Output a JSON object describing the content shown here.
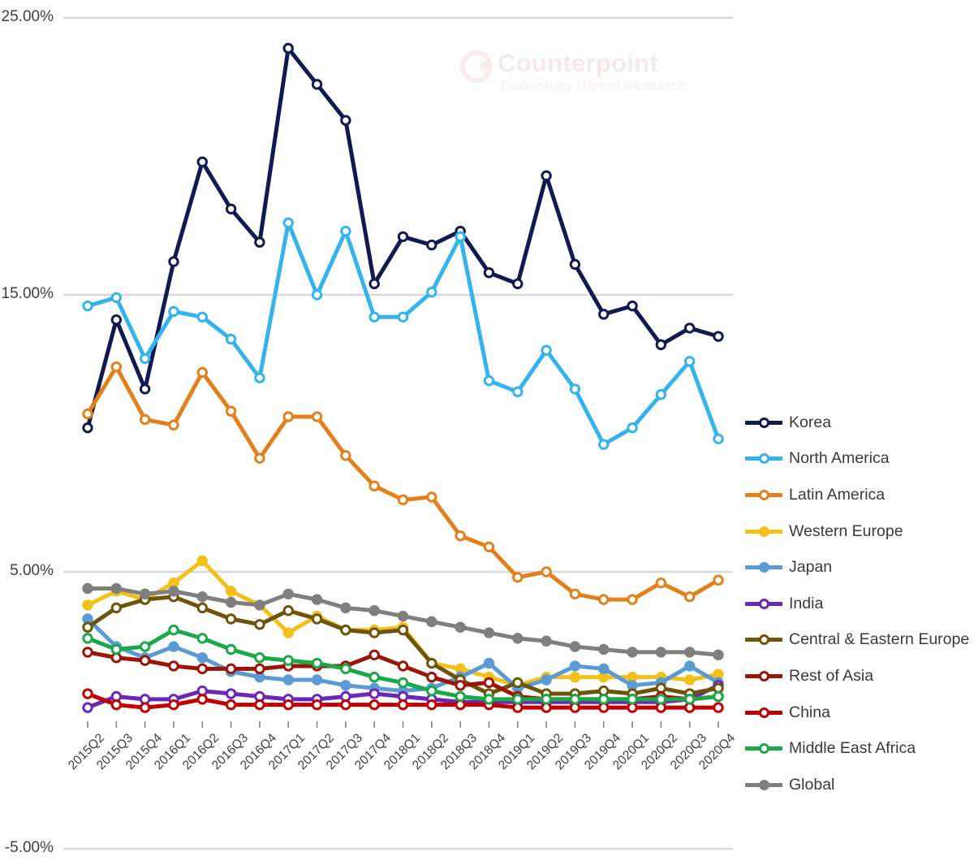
{
  "watermark": {
    "title": "Counterpoint",
    "subtitle": "Technology Market Research",
    "logo_icon": "counterpoint-logo-icon"
  },
  "axes": {
    "y_ticks": [
      "25.00%",
      "15.00%",
      "5.00%",
      "-5.00%"
    ],
    "y_tick_values": [
      25,
      15,
      5,
      -5
    ],
    "x_ticks": [
      "2015Q2",
      "2015Q3",
      "2015Q4",
      "2016Q1",
      "2016Q2",
      "2016Q3",
      "2016Q4",
      "2017Q1",
      "2017Q2",
      "2017Q3",
      "2017Q4",
      "2018Q1",
      "2018Q2",
      "2018Q3",
      "2018Q4",
      "2019Q1",
      "2019Q2",
      "2019Q3",
      "2019Q4",
      "2020Q1",
      "2020Q2",
      "2020Q3",
      "2020Q4"
    ]
  },
  "chart_data": {
    "type": "line",
    "title": "",
    "xlabel": "",
    "ylabel": "",
    "ylim": [
      -5,
      25
    ],
    "grid": true,
    "legend_position": "right",
    "marker": "open-circle",
    "categories": [
      "2015Q2",
      "2015Q3",
      "2015Q4",
      "2016Q1",
      "2016Q2",
      "2016Q3",
      "2016Q4",
      "2017Q1",
      "2017Q2",
      "2017Q3",
      "2017Q4",
      "2018Q1",
      "2018Q2",
      "2018Q3",
      "2018Q4",
      "2019Q1",
      "2019Q2",
      "2019Q3",
      "2019Q4",
      "2020Q1",
      "2020Q2",
      "2020Q3",
      "2020Q4"
    ],
    "series": [
      {
        "name": "Korea",
        "color": "#111a50",
        "marker_fill": "open",
        "values": [
          10.2,
          14.1,
          11.6,
          16.2,
          19.8,
          18.1,
          16.9,
          23.9,
          22.6,
          21.3,
          15.4,
          17.1,
          16.8,
          17.3,
          15.8,
          15.4,
          19.3,
          16.1,
          14.3,
          14.6,
          13.2,
          13.8,
          13.5
        ]
      },
      {
        "name": "North America",
        "color": "#34b3ed",
        "marker_fill": "open",
        "values": [
          14.6,
          14.9,
          12.7,
          14.4,
          14.2,
          13.4,
          12.0,
          17.6,
          15.0,
          17.3,
          14.2,
          14.2,
          15.1,
          17.1,
          11.9,
          11.5,
          13.0,
          11.6,
          9.6,
          10.2,
          11.4,
          12.6,
          9.8
        ]
      },
      {
        "name": "Latin America",
        "color": "#e3801c",
        "marker_fill": "open",
        "values": [
          10.7,
          12.4,
          10.5,
          10.3,
          12.2,
          10.8,
          9.1,
          10.6,
          10.6,
          9.2,
          8.1,
          7.6,
          7.7,
          6.3,
          5.9,
          4.8,
          5.0,
          4.2,
          4.0,
          4.0,
          4.6,
          4.1,
          4.7
        ]
      },
      {
        "name": "Western Europe",
        "color": "#f3c019",
        "marker_fill": "filled",
        "values": [
          3.8,
          4.3,
          4.0,
          4.6,
          5.4,
          4.3,
          3.8,
          2.8,
          3.4,
          2.9,
          2.9,
          3.0,
          1.7,
          1.5,
          1.2,
          0.9,
          1.2,
          1.2,
          1.2,
          1.2,
          1.2,
          1.1,
          1.3
        ]
      },
      {
        "name": "Japan",
        "color": "#5b9bd5",
        "marker_fill": "filled",
        "values": [
          3.3,
          2.3,
          1.9,
          2.3,
          1.9,
          1.4,
          1.2,
          1.1,
          1.1,
          0.9,
          0.8,
          0.7,
          0.8,
          1.2,
          1.7,
          0.8,
          1.1,
          1.6,
          1.5,
          0.9,
          1.0,
          1.6,
          1.0
        ]
      },
      {
        "name": "India",
        "color": "#6b27b5",
        "marker_fill": "open",
        "values": [
          0.1,
          0.5,
          0.4,
          0.4,
          0.7,
          0.6,
          0.5,
          0.4,
          0.4,
          0.5,
          0.6,
          0.5,
          0.4,
          0.3,
          0.3,
          0.3,
          0.3,
          0.3,
          0.3,
          0.3,
          0.3,
          0.4,
          0.9
        ]
      },
      {
        "name": "Central & Eastern Europe",
        "color": "#6e5409",
        "marker_fill": "open",
        "values": [
          3.0,
          3.7,
          4.0,
          4.1,
          3.7,
          3.3,
          3.1,
          3.6,
          3.3,
          2.9,
          2.8,
          2.9,
          1.7,
          1.1,
          0.6,
          1.0,
          0.6,
          0.6,
          0.7,
          0.6,
          0.8,
          0.6,
          0.8
        ]
      },
      {
        "name": "Rest of Asia",
        "color": "#9c1406",
        "marker_fill": "open",
        "values": [
          2.1,
          1.9,
          1.8,
          1.6,
          1.5,
          1.5,
          1.5,
          1.6,
          1.6,
          1.6,
          2.0,
          1.6,
          1.2,
          0.9,
          1.0,
          0.5,
          0.4,
          0.4,
          0.4,
          0.4,
          0.5,
          0.4,
          0.5
        ]
      },
      {
        "name": "China",
        "color": "#c00000",
        "marker_fill": "open",
        "values": [
          0.6,
          0.2,
          0.1,
          0.2,
          0.4,
          0.2,
          0.2,
          0.2,
          0.2,
          0.2,
          0.2,
          0.2,
          0.2,
          0.2,
          0.2,
          0.1,
          0.1,
          0.1,
          0.1,
          0.1,
          0.1,
          0.1,
          0.1
        ]
      },
      {
        "name": "Middle East Africa",
        "color": "#1ba849",
        "marker_fill": "open",
        "values": [
          2.6,
          2.2,
          2.3,
          2.9,
          2.6,
          2.2,
          1.9,
          1.8,
          1.7,
          1.5,
          1.2,
          1.0,
          0.7,
          0.5,
          0.4,
          0.4,
          0.4,
          0.4,
          0.4,
          0.4,
          0.4,
          0.4,
          0.5
        ]
      },
      {
        "name": "Global",
        "color": "#7f7f7f",
        "marker_fill": "filled",
        "values": [
          4.4,
          4.4,
          4.2,
          4.3,
          4.1,
          3.9,
          3.8,
          4.2,
          4.0,
          3.7,
          3.6,
          3.4,
          3.2,
          3.0,
          2.8,
          2.6,
          2.5,
          2.3,
          2.2,
          2.1,
          2.1,
          2.1,
          2.0
        ]
      }
    ]
  },
  "legend": {
    "items": [
      {
        "label": "Korea"
      },
      {
        "label": "North America"
      },
      {
        "label": "Latin America"
      },
      {
        "label": "Western Europe"
      },
      {
        "label": "Japan"
      },
      {
        "label": "India"
      },
      {
        "label": "Central & Eastern Europe"
      },
      {
        "label": "Rest of Asia"
      },
      {
        "label": "China"
      },
      {
        "label": "Middle East Africa"
      },
      {
        "label": "Global"
      }
    ]
  }
}
